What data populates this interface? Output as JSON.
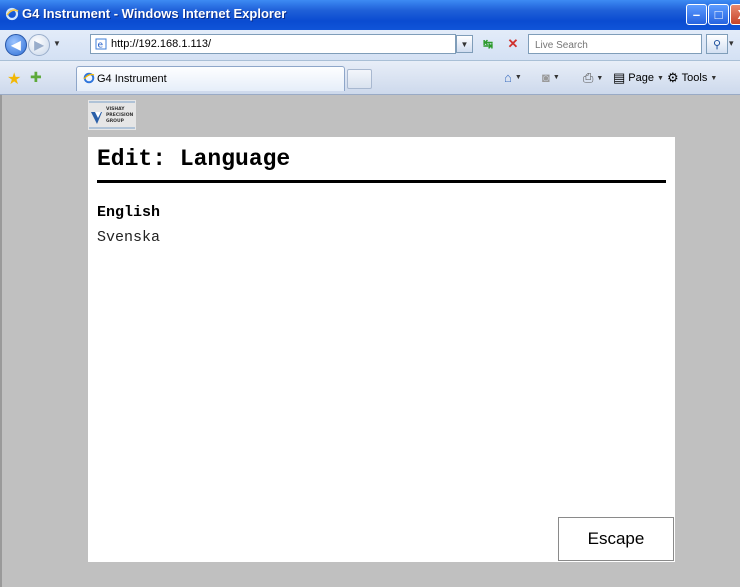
{
  "window": {
    "title": "G4 Instrument - Windows Internet Explorer",
    "minimize_glyph": "–",
    "maximize_glyph": "□",
    "close_glyph": "X"
  },
  "address_bar": {
    "url": "http://192.168.1.113/",
    "search_placeholder": "Live Search"
  },
  "tab": {
    "label": "G4 Instrument"
  },
  "command_bar": {
    "page_label": "Page",
    "tools_label": "Tools"
  },
  "logo": {
    "text_line1": "VISHAY",
    "text_line2": "PRECISION",
    "text_line3": "GROUP"
  },
  "panel": {
    "heading": "Edit: Language",
    "languages": [
      {
        "label": "English",
        "selected": true
      },
      {
        "label": "Svenska",
        "selected": false
      }
    ],
    "escape_label": "Escape"
  },
  "colors": {
    "titlebar": "#0a4bd1",
    "content_bg": "#c0c0c0",
    "panel_bg": "#ffffff"
  }
}
